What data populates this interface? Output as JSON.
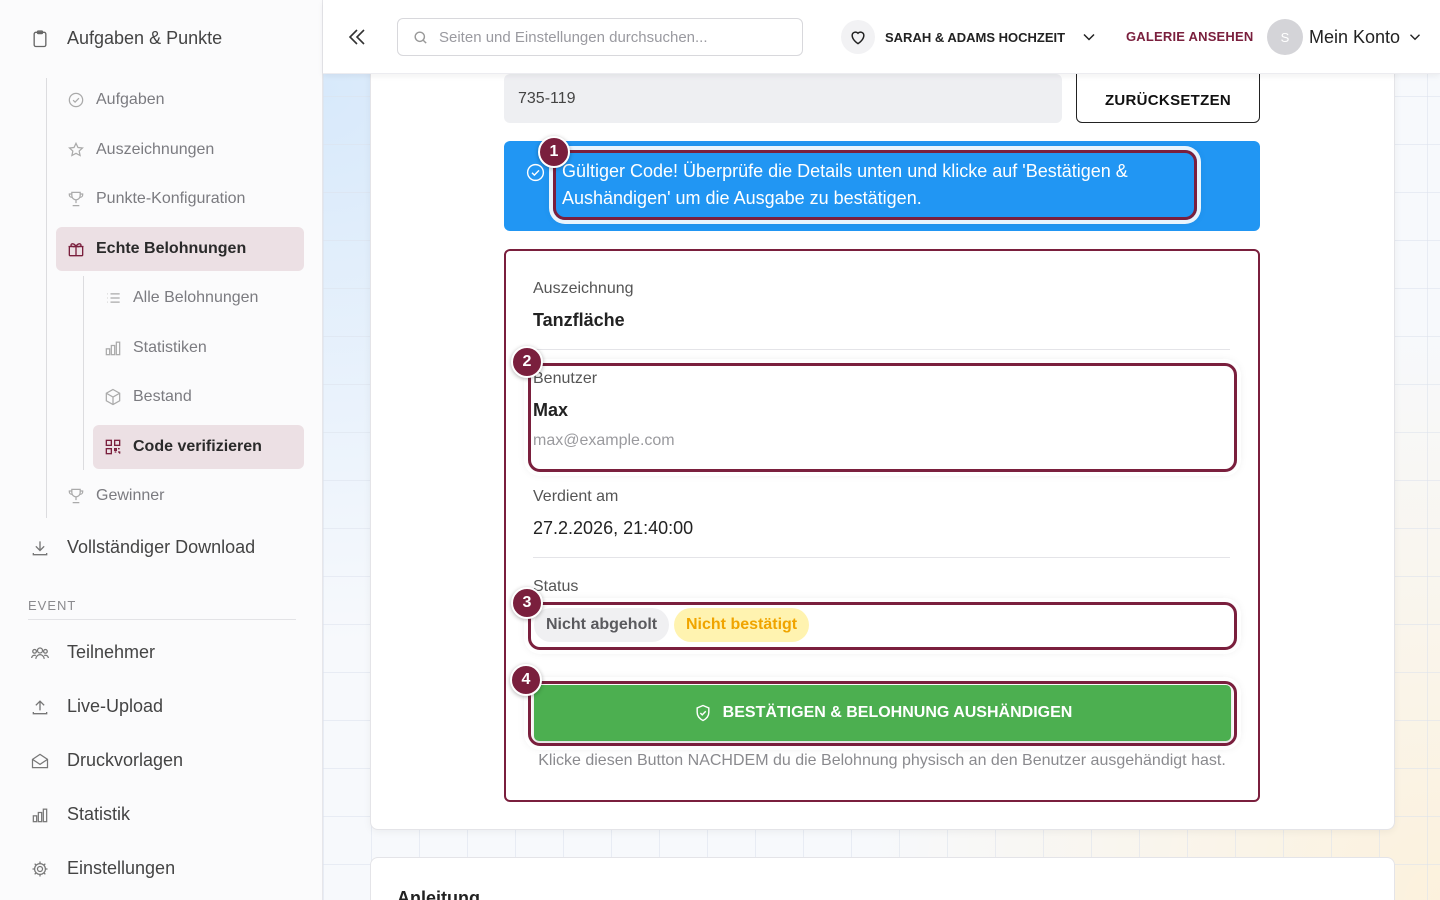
{
  "sidebar": {
    "top_item": "Aufgaben & Punkte",
    "sub_items": [
      {
        "label": "Aufgaben",
        "icon": "check-circle-icon"
      },
      {
        "label": "Auszeichnungen",
        "icon": "star-icon"
      },
      {
        "label": "Punkte-Konfiguration",
        "icon": "trophy-icon"
      },
      {
        "label": "Echte Belohnungen",
        "icon": "gift-icon",
        "active": true
      },
      {
        "label": "Gewinner",
        "icon": "trophy-icon"
      }
    ],
    "reward_items": [
      {
        "label": "Alle Belohnungen",
        "icon": "list-icon"
      },
      {
        "label": "Statistiken",
        "icon": "bar-chart-icon"
      },
      {
        "label": "Bestand",
        "icon": "box-icon"
      },
      {
        "label": "Code verifizieren",
        "icon": "qr-code-icon",
        "active": true
      }
    ],
    "download": "Vollständiger Download",
    "section_label": "EVENT",
    "event_items": [
      {
        "label": "Teilnehmer",
        "icon": "users-icon"
      },
      {
        "label": "Live-Upload",
        "icon": "upload-icon"
      },
      {
        "label": "Druckvorlagen",
        "icon": "envelope-icon"
      },
      {
        "label": "Statistik",
        "icon": "bar-chart-icon"
      },
      {
        "label": "Einstellungen",
        "icon": "gear-icon"
      }
    ]
  },
  "header": {
    "search_placeholder": "Seiten und Einstellungen durchsuchen...",
    "event_name": "SARAH & ADAMS HOCHZEIT",
    "gallery_link": "GALERIE ANSEHEN",
    "avatar_letter": "S",
    "account_label": "Mein Konto"
  },
  "verify": {
    "code_value": "735-119",
    "reset_label": "ZURÜCKSETZEN",
    "alert_text": "Gültiger Code! Überprüfe die Details unten und klicke auf 'Bestätigen & Aushändigen' um die Ausgabe zu bestätigen.",
    "award_label": "Auszeichnung",
    "award_value": "Tanzfläche",
    "user_label": "Benutzer",
    "user_name": "Max",
    "user_email": "max@example.com",
    "earned_label": "Verdient am",
    "earned_value": "27.2.2026, 21:40:00",
    "status_label": "Status",
    "status_chip_1": "Nicht abgeholt",
    "status_chip_2": "Nicht bestätigt",
    "confirm_label": "BESTÄTIGEN & BELOHNUNG AUSHÄNDIGEN",
    "hint": "Klicke diesen Button NACHDEM du die Belohnung physisch an den Benutzer ausgehändigt hast."
  },
  "steps": [
    "1",
    "2",
    "3",
    "4"
  ],
  "next_card_title": "Anleitung",
  "colors": {
    "brand": "#7a1f3d",
    "alert_blue": "#2196f3",
    "confirm_green": "#4caf50",
    "active_bg": "#ece0e4",
    "warning_yellow": "#f0a400"
  }
}
